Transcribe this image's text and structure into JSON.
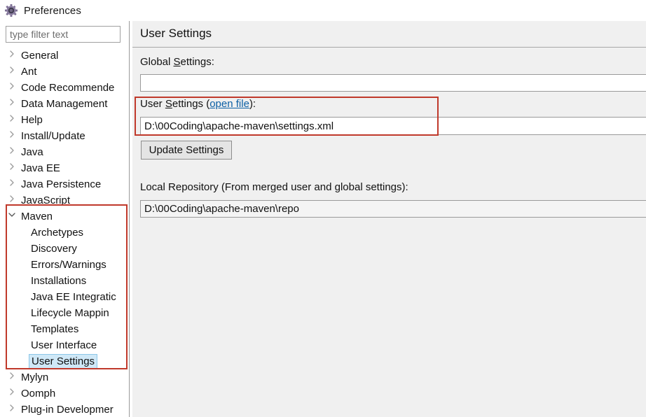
{
  "window": {
    "title": "Preferences",
    "icon": "gear-icon"
  },
  "sidebar": {
    "filter_placeholder": "type filter text",
    "filter_value": "",
    "items": [
      {
        "label": "General",
        "level": 0,
        "expandable": true,
        "expanded": false,
        "selected": false
      },
      {
        "label": "Ant",
        "level": 0,
        "expandable": true,
        "expanded": false,
        "selected": false
      },
      {
        "label": "Code Recommende",
        "level": 0,
        "expandable": true,
        "expanded": false,
        "selected": false
      },
      {
        "label": "Data Management",
        "level": 0,
        "expandable": true,
        "expanded": false,
        "selected": false
      },
      {
        "label": "Help",
        "level": 0,
        "expandable": true,
        "expanded": false,
        "selected": false
      },
      {
        "label": "Install/Update",
        "level": 0,
        "expandable": true,
        "expanded": false,
        "selected": false
      },
      {
        "label": "Java",
        "level": 0,
        "expandable": true,
        "expanded": false,
        "selected": false
      },
      {
        "label": "Java EE",
        "level": 0,
        "expandable": true,
        "expanded": false,
        "selected": false
      },
      {
        "label": "Java Persistence",
        "level": 0,
        "expandable": true,
        "expanded": false,
        "selected": false
      },
      {
        "label": "JavaScript",
        "level": 0,
        "expandable": true,
        "expanded": false,
        "selected": false
      },
      {
        "label": "Maven",
        "level": 0,
        "expandable": true,
        "expanded": true,
        "selected": false
      },
      {
        "label": "Archetypes",
        "level": 1,
        "expandable": false,
        "expanded": false,
        "selected": false
      },
      {
        "label": "Discovery",
        "level": 1,
        "expandable": false,
        "expanded": false,
        "selected": false
      },
      {
        "label": "Errors/Warnings",
        "level": 1,
        "expandable": false,
        "expanded": false,
        "selected": false
      },
      {
        "label": "Installations",
        "level": 1,
        "expandable": false,
        "expanded": false,
        "selected": false
      },
      {
        "label": "Java EE Integratic",
        "level": 1,
        "expandable": false,
        "expanded": false,
        "selected": false
      },
      {
        "label": "Lifecycle Mappin",
        "level": 1,
        "expandable": false,
        "expanded": false,
        "selected": false
      },
      {
        "label": "Templates",
        "level": 1,
        "expandable": false,
        "expanded": false,
        "selected": false
      },
      {
        "label": "User Interface",
        "level": 1,
        "expandable": false,
        "expanded": false,
        "selected": false
      },
      {
        "label": "User Settings",
        "level": 1,
        "expandable": false,
        "expanded": false,
        "selected": true
      },
      {
        "label": "Mylyn",
        "level": 0,
        "expandable": true,
        "expanded": false,
        "selected": false
      },
      {
        "label": "Oomph",
        "level": 0,
        "expandable": true,
        "expanded": false,
        "selected": false
      },
      {
        "label": "Plug-in Developmer",
        "level": 0,
        "expandable": true,
        "expanded": false,
        "selected": false
      }
    ]
  },
  "main": {
    "page_title": "User Settings",
    "global_settings": {
      "label_pre": "Global ",
      "label_mnemonic": "S",
      "label_post": "ettings:",
      "value": "",
      "placeholder": ""
    },
    "user_settings": {
      "label_pre": "User ",
      "label_mnemonic": "S",
      "label_mid": "ettings (",
      "link_text": "open file",
      "label_post": "):",
      "value": "D:\\00Coding\\apache-maven\\settings.xml",
      "placeholder": ""
    },
    "update_button_label": "Update Settings",
    "local_repository": {
      "label": "Local Repository (From merged user and global settings):",
      "value": "D:\\00Coding\\apache-maven\\repo"
    }
  },
  "annotations": {
    "accent_color": "#c0392b",
    "highlight_color": "#cfe8f7",
    "link_color": "#0c5fa5"
  }
}
